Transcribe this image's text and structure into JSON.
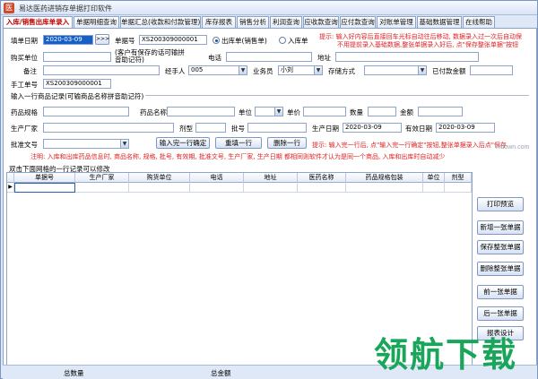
{
  "window": {
    "title": "易达医药进销存单据打印软件"
  },
  "tabs": [
    "入库/销售出库单录入",
    "单据明细查询",
    "单据汇总(收款和付款管理)",
    "库存报表",
    "销售分析",
    "利润查询",
    "应收款查询",
    "应付款查询",
    "对账单管理",
    "基础数据管理",
    "在线帮助"
  ],
  "form": {
    "fill_date_label": "填单日期",
    "fill_date_value": "2020-03-09",
    "fill_date_btn": ">>>",
    "doc_no_label": "单据号",
    "doc_no_value": "XS200309000001",
    "radio_out": "出库单(销售单)",
    "radio_in": "入库单",
    "hint_top_1": "提示: 输入好内容后直接回车光标自动往后移动, 数据录入过一次后自动保",
    "hint_top_2": "不用提前录入基础数据,整张单据录入好后, 点\"保存整张单据\"按钮",
    "buyer_label": "购买单位",
    "buyer_note": "(客户有保存的话可输拼音助记符)",
    "phone_label": "电话",
    "address_label": "地址",
    "remark_label": "备注",
    "handler_label": "经手人",
    "handler_value": "005",
    "salesman_label": "业务员",
    "salesman_value": "小刘",
    "payment_label": "存储方式",
    "paid_label": "已付款金额",
    "manual_no_label": "手工单号",
    "manual_no_value": "XS200309000001"
  },
  "item": {
    "section_title": "输入一行商品记录(可输商品名称拼音助记符)",
    "spec_label": "药品规格",
    "name_label": "药品名称",
    "unit_label": "单位",
    "price_label": "单价",
    "qty_label": "数量",
    "amount_label": "金额",
    "maker_label": "生产厂家",
    "form_label": "剂型",
    "batch_label": "批号",
    "prod_date_label": "生产日期",
    "prod_date_value": "2020-03-09",
    "expire_label": "有效日期",
    "expire_value": "2020-03-09",
    "approval_label": "批准文号",
    "btn_confirm": "输入完一行确定",
    "btn_refill": "重填一行",
    "btn_delete": "删除一行",
    "hint_row": "提示: 输入完一行后, 点\"输入完一行确定\"按钮,整张单据录入后点\"保存",
    "note_line": "注明: 入库和出库药品信息时, 商品名称, 规格, 批号, 有效期, 批准文号, 生产厂家, 生产日期 都相同则软件才认为是同一个商品, 入库和出库时自动减少"
  },
  "grid": {
    "caption": "双击下面网格的一行记录可以修改",
    "columns": [
      "单据号",
      "生产厂家",
      "购货单位",
      "电话",
      "地址",
      "医药名称",
      "药品规格包装",
      "单位",
      "剂型"
    ]
  },
  "side_buttons": [
    "打印预览",
    "新增一张单据",
    "保存整张单据",
    "删除整张单据",
    "前一张单据",
    "后一张单据",
    "报表设计"
  ],
  "status": {
    "total_qty_label": "总数量",
    "total_amount_label": "总金额"
  },
  "watermark": {
    "text": "领航下载",
    "small": "lhdown.com"
  },
  "colors": {
    "accent_red": "#e02020",
    "tab_active": "#c00000",
    "selection": "#1460c8",
    "watermark_green": "#19a55a"
  }
}
